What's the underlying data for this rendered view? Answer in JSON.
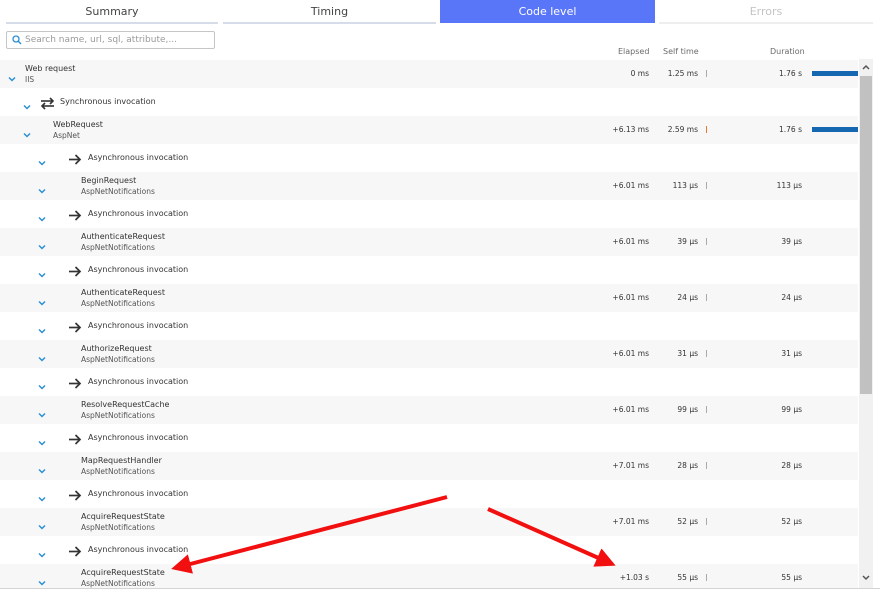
{
  "tabs": [
    {
      "label": "Summary"
    },
    {
      "label": "Timing"
    },
    {
      "label": "Code level"
    },
    {
      "label": "Errors"
    }
  ],
  "search": {
    "placeholder": "Search name, url, sql, attribute,..."
  },
  "columns": {
    "elapsed": "Elapsed",
    "self_time": "Self time",
    "duration": "Duration"
  },
  "rows": [
    {
      "name": "Web request",
      "sub": "IIS",
      "elapsed": "0 ms",
      "self": "1.25 ms",
      "duration": "1.76 s",
      "bar_fraction": 1.0
    },
    {
      "name": "Synchronous invocation",
      "icon": "sync-icon"
    },
    {
      "name": "WebRequest",
      "sub": "AspNet",
      "elapsed": "+6.13 ms",
      "self": "2.59 ms",
      "duration": "1.76 s",
      "bar_fraction": 1.0
    },
    {
      "name": "Asynchronous invocation",
      "icon": "arrow-right-icon"
    },
    {
      "name": "BeginRequest",
      "sub": "AspNetNotifications",
      "elapsed": "+6.01 ms",
      "self": "113 μs",
      "duration": "113 μs"
    },
    {
      "name": "Asynchronous invocation",
      "icon": "arrow-right-icon"
    },
    {
      "name": "AuthenticateRequest",
      "sub": "AspNetNotifications",
      "elapsed": "+6.01 ms",
      "self": "39 μs",
      "duration": "39 μs"
    },
    {
      "name": "Asynchronous invocation",
      "icon": "arrow-right-icon"
    },
    {
      "name": "AuthenticateRequest",
      "sub": "AspNetNotifications",
      "elapsed": "+6.01 ms",
      "self": "24 μs",
      "duration": "24 μs"
    },
    {
      "name": "Asynchronous invocation",
      "icon": "arrow-right-icon"
    },
    {
      "name": "AuthorizeRequest",
      "sub": "AspNetNotifications",
      "elapsed": "+6.01 ms",
      "self": "31 μs",
      "duration": "31 μs"
    },
    {
      "name": "Asynchronous invocation",
      "icon": "arrow-right-icon"
    },
    {
      "name": "ResolveRequestCache",
      "sub": "AspNetNotifications",
      "elapsed": "+6.01 ms",
      "self": "99 μs",
      "duration": "99 μs"
    },
    {
      "name": "Asynchronous invocation",
      "icon": "arrow-right-icon"
    },
    {
      "name": "MapRequestHandler",
      "sub": "AspNetNotifications",
      "elapsed": "+7.01 ms",
      "self": "28 μs",
      "duration": "28 μs"
    },
    {
      "name": "Asynchronous invocation",
      "icon": "arrow-right-icon"
    },
    {
      "name": "AcquireRequestState",
      "sub": "AspNetNotifications",
      "elapsed": "+7.01 ms",
      "self": "52 μs",
      "duration": "52 μs"
    },
    {
      "name": "Asynchronous invocation",
      "icon": "arrow-right-icon"
    },
    {
      "name": "AcquireRequestState",
      "sub": "AspNetNotifications",
      "elapsed": "+1.03 s",
      "self": "55 μs",
      "duration": "55 μs"
    }
  ],
  "colors": {
    "accent": "#5a76f8",
    "bar": "#1467b0",
    "chevron": "#2a8fd0",
    "annotation": "#f20f0f"
  }
}
